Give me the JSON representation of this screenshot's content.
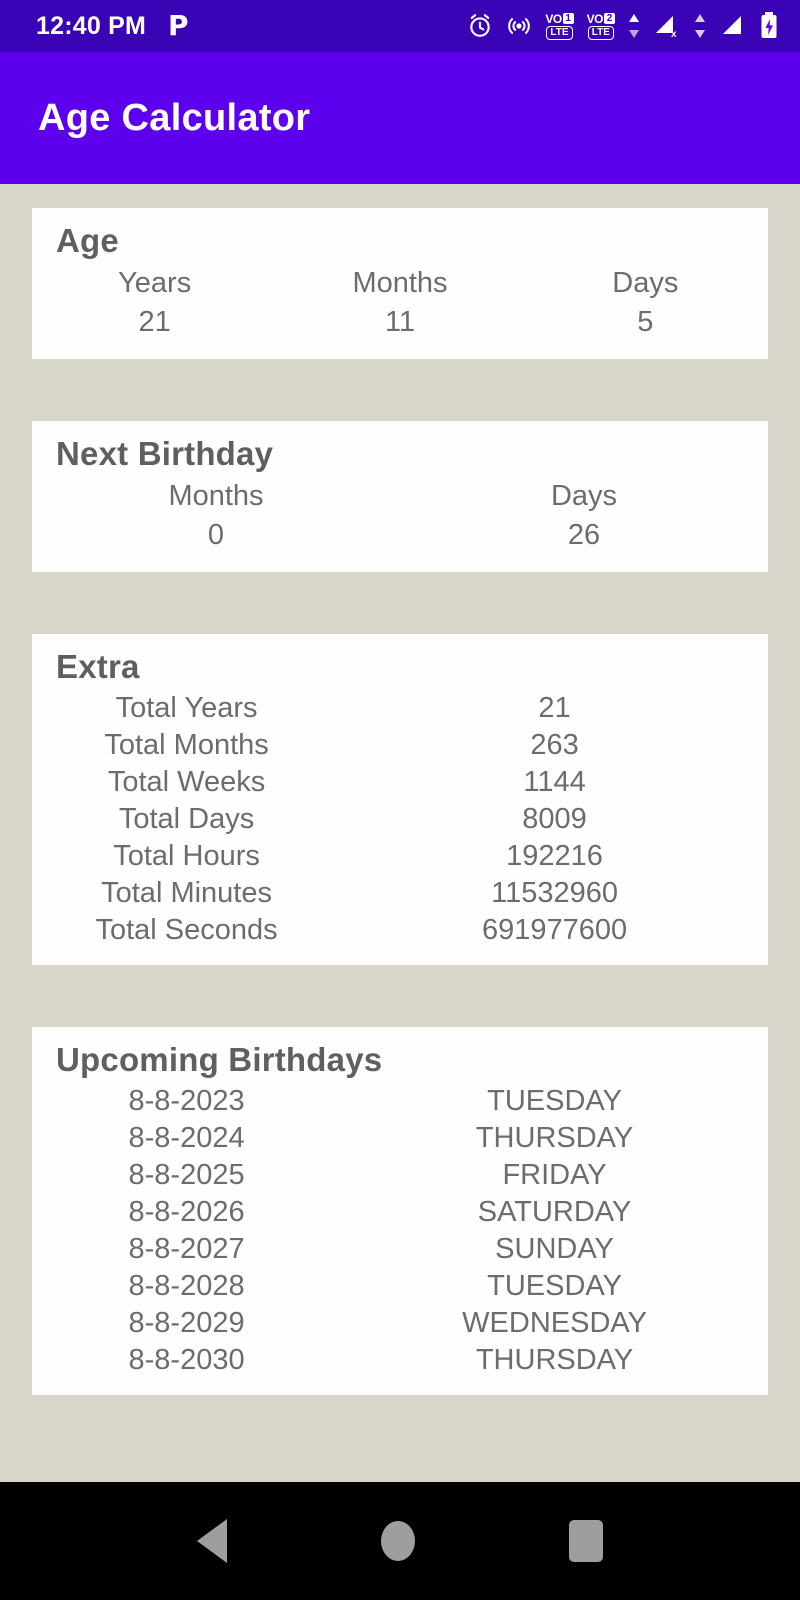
{
  "status_bar": {
    "time": "12:40 PM",
    "app_icon_glyph": "P",
    "icons": [
      "alarm-clock-icon",
      "hotspot-icon",
      "volte-sim1-icon",
      "volte-sim2-icon",
      "data-transfer-icon",
      "signal-no-service-icon",
      "signal-bars-icon",
      "battery-charging-icon"
    ],
    "volte1_label": "VO",
    "volte1_num": "1",
    "volte1_lte": "LTE",
    "volte2_label": "VO",
    "volte2_num": "2",
    "volte2_lte": "LTE",
    "background": "#3a03b5"
  },
  "app_bar": {
    "title": "Age Calculator",
    "background": "#5c00ee",
    "text_color": "#ffffff"
  },
  "theme": {
    "page_background": "#d8d6ca",
    "card_background": "#fefefd",
    "heading_color": "#5f5f5f",
    "body_color": "#6c6c6c"
  },
  "age_card": {
    "title": "Age",
    "columns": [
      {
        "head": "Years",
        "value": "21"
      },
      {
        "head": "Months",
        "value": "11"
      },
      {
        "head": "Days",
        "value": "5"
      }
    ]
  },
  "next_birthday_card": {
    "title": "Next Birthday",
    "columns": [
      {
        "head": "Months",
        "value": "0"
      },
      {
        "head": "Days",
        "value": "26"
      }
    ]
  },
  "extra_card": {
    "title": "Extra",
    "rows": [
      {
        "label": "Total Years",
        "value": "21"
      },
      {
        "label": "Total Months",
        "value": "263"
      },
      {
        "label": "Total Weeks",
        "value": "1144"
      },
      {
        "label": "Total Days",
        "value": "8009"
      },
      {
        "label": "Total Hours",
        "value": "192216"
      },
      {
        "label": "Total Minutes",
        "value": "11532960"
      },
      {
        "label": "Total Seconds",
        "value": "691977600"
      }
    ]
  },
  "upcoming_birthdays_card": {
    "title": "Upcoming Birthdays",
    "rows": [
      {
        "date": "8-8-2023",
        "day": "TUESDAY"
      },
      {
        "date": "8-8-2024",
        "day": "THURSDAY"
      },
      {
        "date": "8-8-2025",
        "day": "FRIDAY"
      },
      {
        "date": "8-8-2026",
        "day": "SATURDAY"
      },
      {
        "date": "8-8-2027",
        "day": "SUNDAY"
      },
      {
        "date": "8-8-2028",
        "day": "TUESDAY"
      },
      {
        "date": "8-8-2029",
        "day": "WEDNESDAY"
      },
      {
        "date": "8-8-2030",
        "day": "THURSDAY"
      }
    ]
  },
  "nav_bar": {
    "buttons": [
      "back-button",
      "home-button",
      "recents-button"
    ],
    "background": "#000000"
  }
}
